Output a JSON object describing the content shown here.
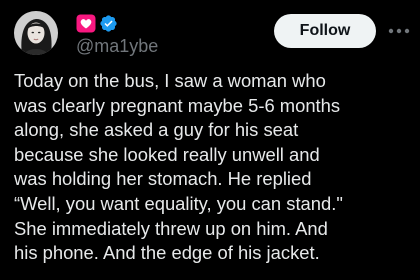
{
  "colors": {
    "background": "#000000",
    "text": "#e7e9ea",
    "secondary_text": "#71767b",
    "follow_bg": "#eff3f4",
    "heart_badge": "#f91880",
    "verified": "#1d9bf0"
  },
  "author": {
    "handle": "@ma1ybe",
    "name_icons": [
      "heart-icon",
      "verified-icon"
    ]
  },
  "actions": {
    "follow_label": "Follow",
    "more_icon": "more-icon"
  },
  "tweet": {
    "lines": [
      "Today on the bus, I saw a woman who",
      "was clearly pregnant maybe 5-6 months",
      "along, she asked a guy for his seat",
      "because she looked really unwell and",
      "was holding her stomach. He replied",
      "“Well, you want equality, you can stand.\"",
      "She immediately threw up on him. And",
      "his phone. And the edge of his jacket."
    ]
  }
}
